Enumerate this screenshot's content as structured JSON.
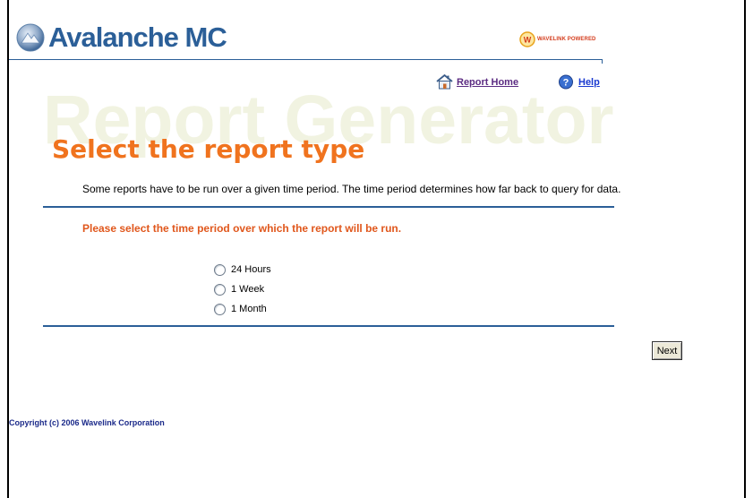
{
  "brand": {
    "name": "Avalanche MC",
    "powered_by": "WAVELINK POWERED",
    "powered_icon_letter": "W",
    "accent_color": "#2b5f98",
    "orange_color": "#f0731e"
  },
  "nav": {
    "report_home_label": "Report Home",
    "report_home_icon": "house-icon",
    "help_label": "Help",
    "help_icon": "help-icon"
  },
  "watermark": "Report Generator",
  "page_title": "Select the report type",
  "description": "Some reports have to be run over a given time period. The time period determines how far back to query for data.",
  "instruction": "Please select the time period over which the report will be run.",
  "options": [
    {
      "label": "24 Hours",
      "selected": false
    },
    {
      "label": "1 Week",
      "selected": false
    },
    {
      "label": "1 Month",
      "selected": false
    }
  ],
  "next_label": "Next",
  "copyright": "Copyright (c) 2006 Wavelink Corporation"
}
